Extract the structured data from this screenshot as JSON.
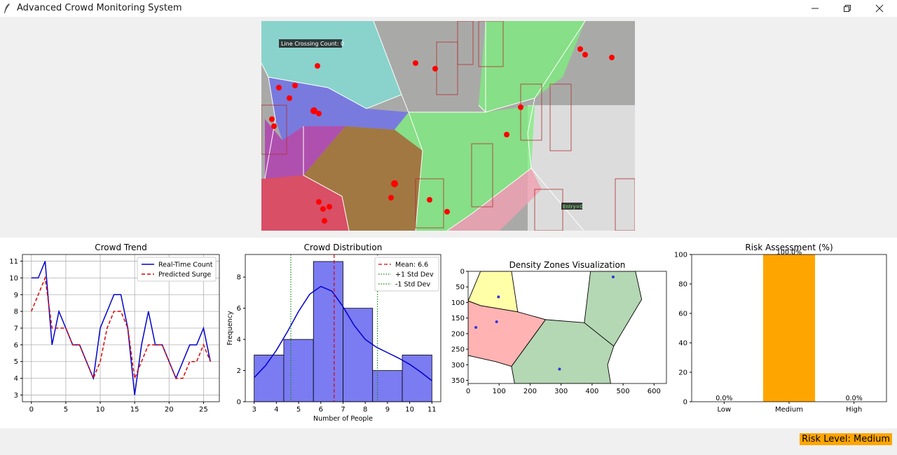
{
  "window": {
    "title": "Advanced Crowd Monitoring System",
    "controls": [
      "minimize-icon",
      "restore-icon",
      "close-icon"
    ]
  },
  "video": {
    "line_crossing_label": "Line Crossing Count: 0",
    "entry_label": "Entry=0"
  },
  "charts": [
    {
      "id": "trend",
      "type": "line",
      "title": "Crowd Trend",
      "xlabel": "",
      "ylabel": "",
      "x_ticks": [
        "0",
        "5",
        "10",
        "15",
        "20",
        "25"
      ],
      "y_ticks": [
        "3",
        "4",
        "5",
        "6",
        "7",
        "8",
        "9",
        "10",
        "11"
      ],
      "xlim": [
        -1.3,
        27.3
      ],
      "ylim": [
        2.6,
        11.4
      ],
      "grid": true,
      "legend": "top-right",
      "series": [
        {
          "name": "Real-Time Count",
          "color": "#0000cc",
          "style": "solid",
          "values": [
            10,
            10,
            11,
            6,
            8,
            7,
            6,
            6,
            5,
            4,
            7,
            8,
            9,
            9,
            7,
            3,
            6,
            8,
            6,
            6,
            5,
            4,
            5,
            6,
            6,
            7,
            5
          ]
        },
        {
          "name": "Predicted Surge",
          "color": "#e00000",
          "style": "dashed",
          "values": [
            8,
            9,
            10,
            7,
            7,
            7,
            6,
            6,
            5,
            4,
            5,
            7,
            8,
            8,
            7,
            4,
            5,
            6,
            6,
            6,
            5,
            4,
            4,
            5,
            5,
            6,
            5
          ]
        }
      ]
    },
    {
      "id": "distribution",
      "type": "bar",
      "title": "Crowd Distribution",
      "xlabel": "Number of People",
      "ylabel": "Frequency",
      "x_ticks": [
        "3",
        "4",
        "5",
        "6",
        "7",
        "8",
        "9",
        "10",
        "11"
      ],
      "y_ticks": [
        "0",
        "2",
        "4",
        "6",
        "8"
      ],
      "xlim": [
        2.6,
        11.4
      ],
      "ylim": [
        0,
        9.45
      ],
      "legend": "top-right",
      "bins": [
        {
          "from": 3.0,
          "to": 4.333,
          "count": 3
        },
        {
          "from": 4.333,
          "to": 5.667,
          "count": 4
        },
        {
          "from": 5.667,
          "to": 7.0,
          "count": 9
        },
        {
          "from": 7.0,
          "to": 8.333,
          "count": 6
        },
        {
          "from": 8.333,
          "to": 9.667,
          "count": 2
        },
        {
          "from": 9.667,
          "to": 11.0,
          "count": 3
        }
      ],
      "kde": [
        [
          3.0,
          1.55
        ],
        [
          3.5,
          2.3
        ],
        [
          4.0,
          3.3
        ],
        [
          4.5,
          4.5
        ],
        [
          5.0,
          5.8
        ],
        [
          5.5,
          6.9
        ],
        [
          6.0,
          7.4
        ],
        [
          6.5,
          7.1
        ],
        [
          7.0,
          6.1
        ],
        [
          7.5,
          4.9
        ],
        [
          8.0,
          4.0
        ],
        [
          8.5,
          3.5
        ],
        [
          9.0,
          3.15
        ],
        [
          9.5,
          2.8
        ],
        [
          10.0,
          2.4
        ],
        [
          10.5,
          1.9
        ],
        [
          11.0,
          1.35
        ]
      ],
      "mean": 6.6,
      "std_plus": 8.55,
      "std_minus": 4.65,
      "legend_entries": [
        "Mean: 6.6",
        "+1 Std Dev",
        "-1 Std Dev"
      ],
      "colors": {
        "bar": "#7b7bf2",
        "kde": "#0000cc",
        "mean": "#e00000",
        "std": "#118811"
      }
    },
    {
      "id": "density",
      "type": "scatter",
      "title": "Density Zones Visualization",
      "x_ticks": [
        "0",
        "100",
        "200",
        "300",
        "400",
        "500",
        "600"
      ],
      "y_ticks": [
        "0",
        "50",
        "100",
        "150",
        "200",
        "250",
        "300",
        "350"
      ],
      "xlim": [
        0,
        640
      ],
      "ylim": [
        360,
        0
      ],
      "zones": [
        {
          "color": "#ffffa8",
          "points": [
            [
              0,
              95
            ],
            [
              40,
              0
            ],
            [
              140,
              0
            ],
            [
              160,
              130
            ],
            [
              40,
              110
            ]
          ]
        },
        {
          "color": "#ffb3b3",
          "points": [
            [
              0,
              95
            ],
            [
              40,
              110
            ],
            [
              160,
              130
            ],
            [
              250,
              155
            ],
            [
              140,
              305
            ],
            [
              90,
              290
            ],
            [
              0,
              270
            ]
          ]
        },
        {
          "color": "#b4d7b4",
          "points": [
            [
              250,
              155
            ],
            [
              140,
              305
            ],
            [
              150,
              360
            ],
            [
              460,
              360
            ],
            [
              450,
              300
            ],
            [
              470,
              240
            ],
            [
              375,
              165
            ]
          ]
        },
        {
          "color": "#b4d7b4",
          "points": [
            [
              375,
              165
            ],
            [
              470,
              240
            ],
            [
              560,
              90
            ],
            [
              540,
              0
            ],
            [
              395,
              0
            ]
          ]
        }
      ],
      "points": [
        [
          98,
          82
        ],
        [
          92,
          162
        ],
        [
          25,
          180
        ],
        [
          295,
          314
        ],
        [
          468,
          18
        ]
      ]
    },
    {
      "id": "risk",
      "type": "bar",
      "title": "Risk Assessment (%)",
      "categories": [
        "Low",
        "Medium",
        "High"
      ],
      "values": [
        0.0,
        100.0,
        0.0
      ],
      "data_labels": [
        "0.0%",
        "100.0%",
        "0.0%"
      ],
      "y_ticks": [
        "0",
        "20",
        "40",
        "60",
        "80",
        "100"
      ],
      "ylim": [
        0,
        100
      ],
      "bar_color": "#ffa500"
    }
  ],
  "status": {
    "risk_level": "Risk Level: Medium"
  }
}
